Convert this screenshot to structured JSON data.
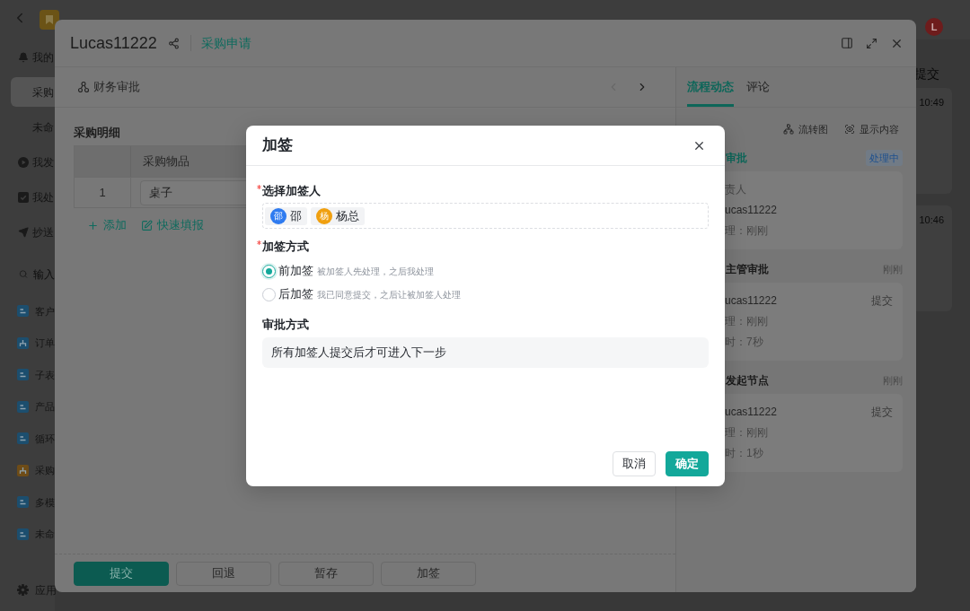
{
  "app": {
    "avatar": "L",
    "nav": [
      {
        "label": "我的",
        "kind": "todo",
        "selected": false,
        "children": [
          {
            "label": "采购",
            "selected": true
          },
          {
            "label": "未命",
            "selected": false
          }
        ]
      },
      {
        "label": "我发",
        "kind": "started",
        "selected": false
      },
      {
        "label": "我处",
        "kind": "handled",
        "selected": false
      },
      {
        "label": "抄送",
        "kind": "cc",
        "selected": false
      }
    ],
    "search": {
      "placeholder": "输入"
    },
    "forms": [
      {
        "label": "客户",
        "kind": "form",
        "color": "#1c4e6e",
        "selected": false
      },
      {
        "label": "订单",
        "kind": "flow",
        "color": "#1c4e6e",
        "selected": false
      },
      {
        "label": "子表",
        "kind": "form",
        "color": "#1c4e6e",
        "selected": false
      },
      {
        "label": "产品",
        "kind": "form",
        "color": "#1c4e6e",
        "selected": false
      },
      {
        "label": "循环",
        "kind": "form",
        "color": "#1c4e6e",
        "selected": false
      },
      {
        "label": "采购",
        "kind": "flow",
        "color": "#6e4c17",
        "selected": false
      },
      {
        "label": "多模",
        "kind": "form",
        "color": "#1c4e6e",
        "selected": false
      },
      {
        "label": "未命",
        "kind": "form",
        "color": "#1c4e6e",
        "selected": false
      }
    ],
    "settings": "应用",
    "peek": {
      "label": "提交",
      "times": [
        "10:49",
        "10:46"
      ]
    }
  },
  "record": {
    "title": "Lucas11222",
    "form": "采购申请",
    "node": "财务审批",
    "pager": [
      {
        "kind": "prev",
        "disabled": true
      },
      {
        "kind": "next",
        "disabled": false
      }
    ],
    "section": "采购明细",
    "table": {
      "columns": [
        "采购物品"
      ],
      "rows": [
        {
          "index": "1",
          "cells": [
            "桌子"
          ]
        }
      ]
    },
    "links": [
      {
        "kind": "add",
        "label": "添加"
      },
      {
        "kind": "quick_fill",
        "label": "快速填报"
      }
    ],
    "actions": [
      {
        "label": "提交",
        "kind": "primary"
      },
      {
        "label": "回退",
        "kind": "default"
      },
      {
        "label": "暂存",
        "kind": "default"
      },
      {
        "label": "加签",
        "kind": "default"
      }
    ],
    "side": {
      "tabs": [
        {
          "label": "流程动态",
          "selected": true
        },
        {
          "label": "评论",
          "selected": false
        }
      ],
      "tools": [
        {
          "kind": "flow_chart",
          "label": "流转图"
        },
        {
          "kind": "show_content",
          "label": "显示内容"
        }
      ],
      "steps": [
        {
          "title": "审批",
          "current": true,
          "status": "处理中",
          "rows": [
            {
              "kind": "meta",
              "text": "责人"
            },
            {
              "kind": "name",
              "text": "ucas11222"
            },
            {
              "kind": "meta",
              "text": "理：刚刚"
            }
          ]
        },
        {
          "title": "主管审批",
          "current": false,
          "time": "刚刚",
          "rows": [
            {
              "kind": "name",
              "text": "ucas11222",
              "action": "提交"
            },
            {
              "kind": "meta",
              "text": "理：刚刚"
            },
            {
              "kind": "meta",
              "text": "时：7秒"
            }
          ]
        },
        {
          "title": "发起节点",
          "current": false,
          "time": "刚刚",
          "rows": [
            {
              "kind": "name",
              "text": "ucas11222",
              "action": "提交"
            },
            {
              "kind": "meta",
              "text": "理：刚刚"
            },
            {
              "kind": "meta",
              "text": "时：1秒"
            }
          ]
        }
      ]
    }
  },
  "dialog": {
    "title": "加签",
    "fields": [
      {
        "kind": "people",
        "label": "选择加签人",
        "required": true,
        "people": [
          {
            "avatar": "邵",
            "name": "邵",
            "color": "#2f7bf0"
          },
          {
            "avatar": "杨",
            "name": "杨总",
            "color": "#f0a010"
          }
        ]
      },
      {
        "kind": "radio",
        "label": "加签方式",
        "required": true,
        "options": [
          {
            "label": "前加签",
            "hint": "被加签人先处理，之后我处理",
            "selected": true
          },
          {
            "label": "后加签",
            "hint": "我已同意提交，之后让被加签人处理",
            "selected": false
          }
        ]
      },
      {
        "kind": "readonly",
        "label": "审批方式",
        "required": false,
        "value": "所有加签人提交后才可进入下一步"
      }
    ],
    "buttons": [
      {
        "label": "取消",
        "kind": "default"
      },
      {
        "label": "确定",
        "kind": "primary"
      }
    ]
  }
}
